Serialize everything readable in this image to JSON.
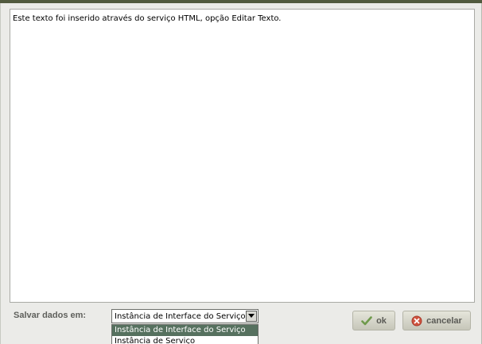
{
  "editor": {
    "content": "Este texto foi inserido através do serviço HTML, opção Editar Texto."
  },
  "save": {
    "label": "Salvar dados em:",
    "selected": "Instância de Interface do Serviço",
    "options": [
      "Instância de Interface do Serviço",
      "Instância de Serviço"
    ]
  },
  "buttons": {
    "ok_label": "ok",
    "ok_icon": "checkmark-icon",
    "cancel_label": "cancelar",
    "cancel_icon": "cancel-circle-icon"
  },
  "colors": {
    "title_bar": "#515a3e",
    "selected_option_bg": "#56715f",
    "cancel_icon": "#d0533e",
    "ok_icon": "#6f9a4c"
  }
}
